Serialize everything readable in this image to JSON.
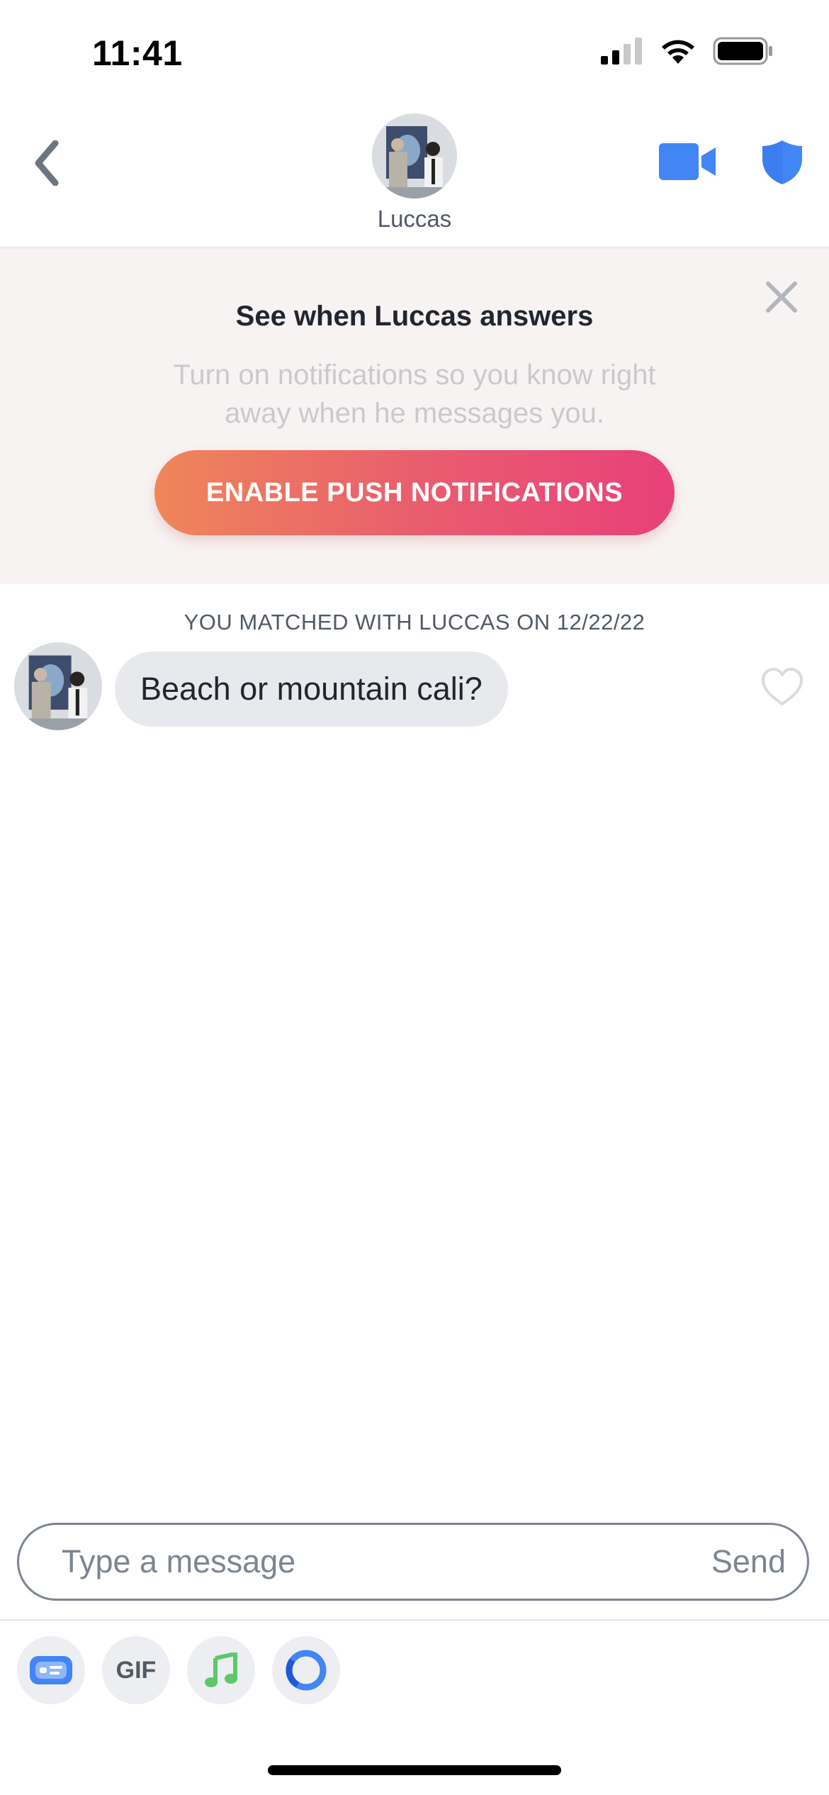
{
  "status_bar": {
    "time": "11:41"
  },
  "header": {
    "contact_name": "Luccas"
  },
  "banner": {
    "title": "See when Luccas answers",
    "body": "Turn on notifications so you know right away when he messages you.",
    "button_label": "ENABLE PUSH NOTIFICATIONS"
  },
  "chat": {
    "match_label": "YOU MATCHED WITH LUCCAS ON 12/22/22",
    "messages": [
      {
        "text": "Beach or mountain cali?"
      }
    ]
  },
  "composer": {
    "placeholder": "Type a message",
    "send_label": "Send"
  },
  "tools": {
    "gif_label": "GIF"
  },
  "colors": {
    "accent_blue": "#4285f4",
    "gradient_start": "#ef8659",
    "gradient_end": "#e9407a",
    "music_green": "#5cc86b"
  }
}
